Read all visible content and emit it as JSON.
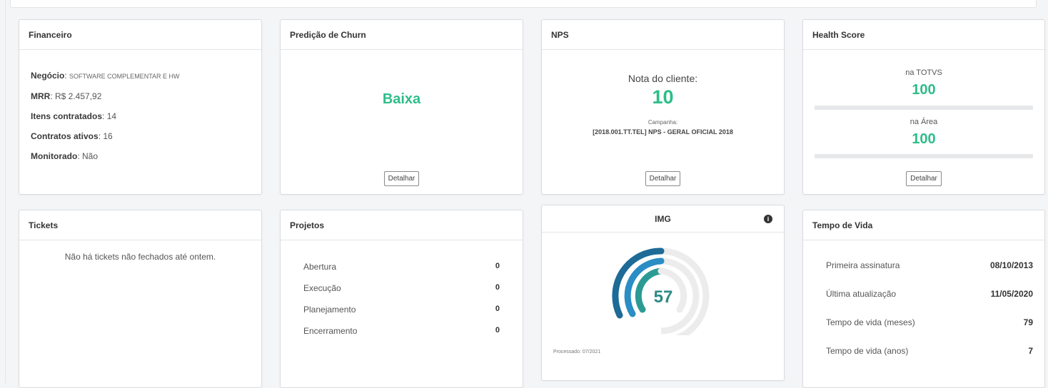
{
  "financeiro": {
    "title": "Financeiro",
    "negocio_label": "Negócio",
    "negocio_value": "SOFTWARE COMPLEMENTAR E HW",
    "mrr_label": "MRR",
    "mrr_value": "R$ 2.457,92",
    "itens_label": "Itens contratados",
    "itens_value": "14",
    "contratos_label": "Contratos ativos",
    "contratos_value": "16",
    "monitorado_label": "Monitorado",
    "monitorado_value": "Não"
  },
  "churn": {
    "title": "Predição de Churn",
    "value": "Baixa",
    "button": "Detalhar"
  },
  "nps": {
    "title": "NPS",
    "score_label": "Nota do cliente:",
    "score": "10",
    "campaign_label": "Campanha:",
    "campaign": "[2018.001.TT.TEL] NPS - GERAL OFICIAL 2018",
    "button": "Detalhar"
  },
  "health": {
    "title": "Health Score",
    "totvs_label": "na TOTVS",
    "totvs_value": "100",
    "area_label": "na Área",
    "area_value": "100",
    "button": "Detalhar"
  },
  "tickets": {
    "title": "Tickets",
    "message": "Não há tickets não fechados até ontem."
  },
  "projetos": {
    "title": "Projetos",
    "rows": [
      {
        "label": "Abertura",
        "value": "0"
      },
      {
        "label": "Execução",
        "value": "0"
      },
      {
        "label": "Planejamento",
        "value": "0"
      },
      {
        "label": "Encerramento",
        "value": "0"
      }
    ]
  },
  "img": {
    "title": "IMG",
    "info_glyph": "i",
    "score": "57",
    "processed": "Processado: 07/2021",
    "colors": {
      "outer": "#1d6b96",
      "middle": "#2a8dc4",
      "inner": "#2c9a94",
      "track": "#ececec"
    }
  },
  "tempo_vida": {
    "title": "Tempo de Vida",
    "rows": [
      {
        "label": "Primeira assinatura",
        "value": "08/10/2013"
      },
      {
        "label": "Última atualização",
        "value": "11/05/2020"
      },
      {
        "label": "Tempo de vida (meses)",
        "value": "79"
      },
      {
        "label": "Tempo de vida (anos)",
        "value": "7"
      }
    ]
  },
  "colors": {
    "accent_green": "#2ebd8a"
  }
}
